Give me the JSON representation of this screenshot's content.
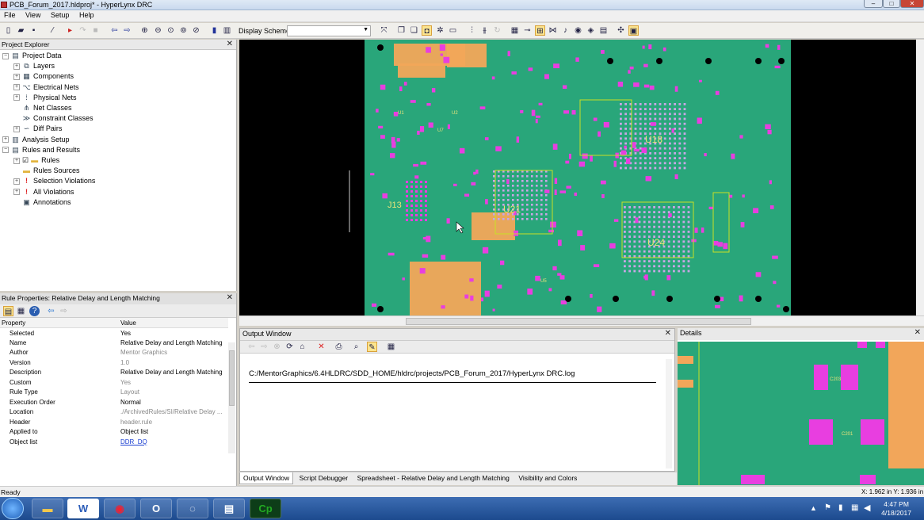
{
  "window": {
    "title": "PCB_Forum_2017.hldproj* - HyperLynx DRC",
    "buttons": [
      "–",
      "□",
      "✕"
    ]
  },
  "menu": [
    "File",
    "View",
    "Setup",
    "Help"
  ],
  "toolbar": {
    "display_scheme_label": "Display Scheme",
    "display_scheme_value": ""
  },
  "project_explorer": {
    "title": "Project Explorer",
    "items": [
      {
        "label": "Project Data",
        "icon": "project-data-icon",
        "glyph": "▤"
      },
      {
        "label": "Layers",
        "icon": "layers-icon",
        "glyph": "⧉"
      },
      {
        "label": "Components",
        "icon": "components-icon",
        "glyph": "▦"
      },
      {
        "label": "Electrical Nets",
        "icon": "electrical-nets-icon",
        "glyph": "⌥"
      },
      {
        "label": "Physical Nets",
        "icon": "physical-nets-icon",
        "glyph": "⁞"
      },
      {
        "label": "Net Classes",
        "icon": "net-classes-icon",
        "glyph": "⋔"
      },
      {
        "label": "Constraint Classes",
        "icon": "constraint-classes-icon",
        "glyph": "≫"
      },
      {
        "label": "Diff Pairs",
        "icon": "diff-pairs-icon",
        "glyph": "∽"
      },
      {
        "label": "Analysis Setup",
        "icon": "analysis-setup-icon",
        "glyph": "▥"
      },
      {
        "label": "Rules and Results",
        "icon": "rules-results-icon",
        "glyph": "▤"
      },
      {
        "label": "Rules",
        "icon": "rules-folder-icon",
        "glyph": "▬"
      },
      {
        "label": "Rules Sources",
        "icon": "rules-sources-folder-icon",
        "glyph": "▬"
      },
      {
        "label": "Selection Violations",
        "icon": "selection-violations-icon",
        "glyph": "!"
      },
      {
        "label": "All Violations",
        "icon": "all-violations-icon",
        "glyph": "!"
      },
      {
        "label": "Annotations",
        "icon": "annotations-icon",
        "glyph": "▣"
      }
    ]
  },
  "rule_properties": {
    "title": "Rule Properties: Relative Delay and Length Matching",
    "col_property": "Property",
    "col_value": "Value",
    "rows": [
      {
        "k": "Selected",
        "v": "Yes"
      },
      {
        "k": "Name",
        "v": "Relative Delay and Length Matching"
      },
      {
        "k": "Author",
        "v": "Mentor Graphics"
      },
      {
        "k": "Version",
        "v": "1.0"
      },
      {
        "k": "Description",
        "v": "Relative Delay and Length Matching"
      },
      {
        "k": "Custom",
        "v": "Yes"
      },
      {
        "k": "Rule Type",
        "v": "Layout"
      },
      {
        "k": "Execution Order",
        "v": "Normal"
      },
      {
        "k": "Location",
        "v": "./ArchivedRules/SI/Relative Delay ..."
      },
      {
        "k": "Header",
        "v": "header.rule"
      },
      {
        "k": "Applied to",
        "v": "Object list"
      },
      {
        "k": "Object list",
        "v": "DDR_DQ"
      }
    ]
  },
  "board": {
    "labels": [
      "U18",
      "J13",
      "U21",
      "U24",
      "U1",
      "U2",
      "U7",
      "U5"
    ],
    "colors": {
      "board": "#29a67a",
      "pad": "#e83ee0",
      "copper": "#f2a65a",
      "outline": "#c9e024",
      "hole": "#000000"
    }
  },
  "output": {
    "title": "Output Window",
    "log_path": "C:/MentorGraphics/6.4HLDRC/SDD_HOME/hldrc/projects/PCB_Forum_2017/HyperLynx DRC.log"
  },
  "details": {
    "title": "Details",
    "labels": [
      "C203",
      "C201"
    ]
  },
  "tabs": [
    "Output Window",
    "Script Debugger",
    "Spreadsheet - Relative Delay and Length Matching",
    "Visibility and Colors"
  ],
  "status": {
    "left": "Ready",
    "coords": "X: 1.962 in  Y: 1.936 in"
  },
  "taskbar": {
    "time": "4:47 PM",
    "date": "4/18/2017"
  }
}
